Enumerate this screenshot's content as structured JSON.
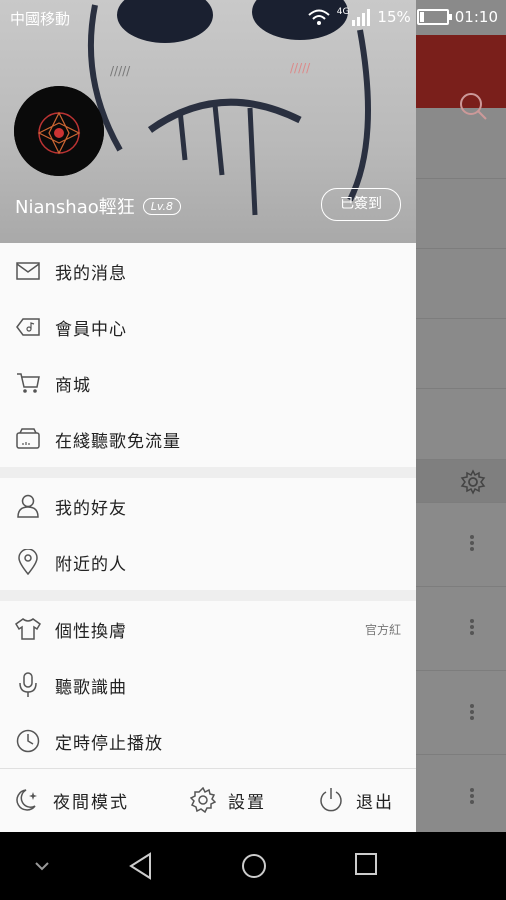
{
  "status_bar": {
    "carrier": "中國移動",
    "network": "4G",
    "battery": "15%",
    "battery_level": 0.15,
    "time": "01:10"
  },
  "profile": {
    "username": "Nianshao輕狂",
    "level": "Lv.8",
    "checkin_label": "已簽到"
  },
  "menu": {
    "group1": [
      {
        "label": "我的消息",
        "icon": "mail-icon"
      },
      {
        "label": "會員中心",
        "icon": "vip-diamond-icon"
      },
      {
        "label": "商城",
        "icon": "cart-icon"
      },
      {
        "label": "在綫聽歌免流量",
        "icon": "sim-card-icon"
      }
    ],
    "group2": [
      {
        "label": "我的好友",
        "icon": "person-icon"
      },
      {
        "label": "附近的人",
        "icon": "location-pin-icon"
      }
    ],
    "group3": [
      {
        "label": "個性換膚",
        "icon": "tshirt-icon",
        "right": "官方紅"
      },
      {
        "label": "聽歌識曲",
        "icon": "mic-icon"
      },
      {
        "label": "定時停止播放",
        "icon": "clock-icon"
      }
    ]
  },
  "bottom_bar": {
    "night_mode": "夜間模式",
    "settings": "設置",
    "exit": "退出"
  },
  "colors": {
    "brand_red": "#7a1f1b",
    "drawer_bg": "#fafafa"
  }
}
